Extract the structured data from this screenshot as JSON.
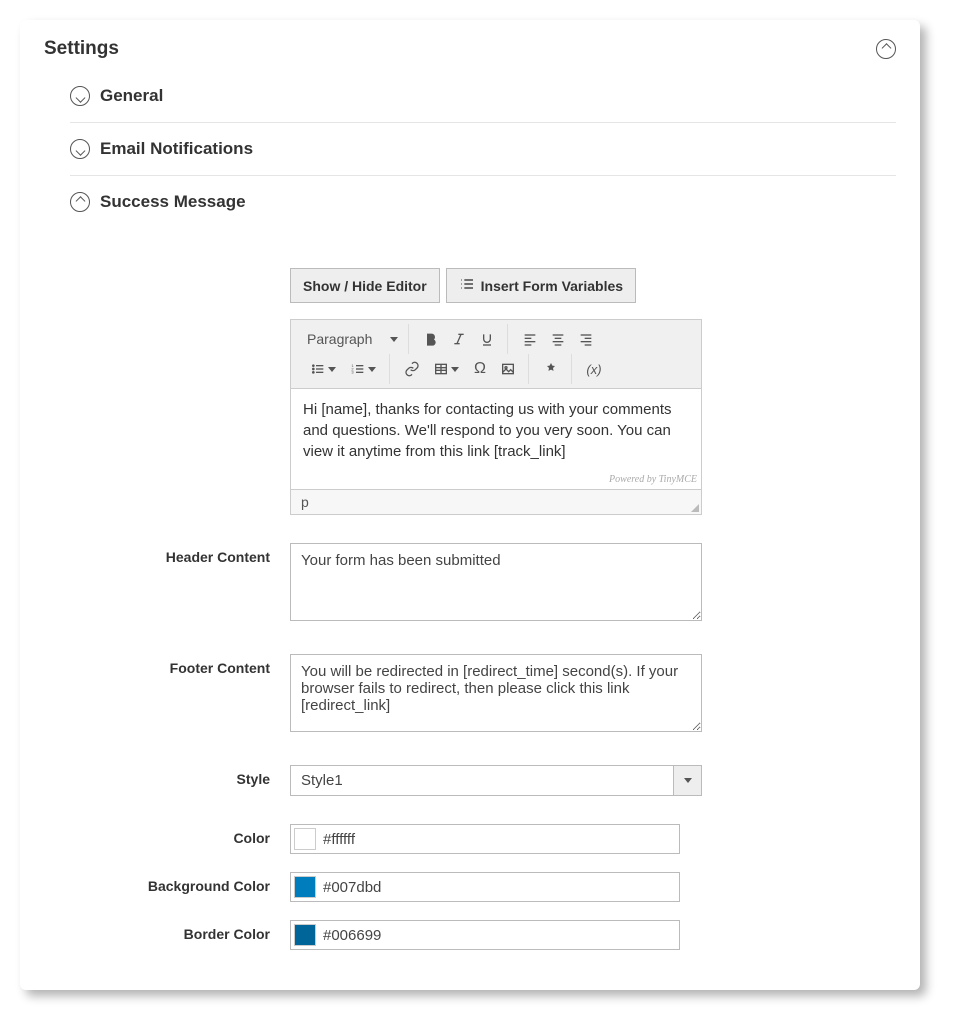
{
  "panel": {
    "title": "Settings"
  },
  "sections": {
    "general": {
      "title": "General"
    },
    "email": {
      "title": "Email Notifications"
    },
    "success": {
      "title": "Success Message"
    }
  },
  "buttons": {
    "toggle_editor": "Show / Hide Editor",
    "insert_vars": "Insert Form Variables"
  },
  "editor": {
    "format_label": "Paragraph",
    "content": "Hi [name], thanks for contacting us with your comments and questions. We'll respond to you very soon. You can view it anytime from this link [track_link]",
    "powered": "Powered by TinyMCE",
    "status_path": "p"
  },
  "fields": {
    "header": {
      "label": "Header Content",
      "value": "Your form has been submitted"
    },
    "footer": {
      "label": "Footer Content",
      "value": "You will be redirected in [redirect_time] second(s). If your browser fails to redirect, then please click this link [redirect_link]"
    },
    "style": {
      "label": "Style",
      "value": "Style1"
    },
    "color": {
      "label": "Color",
      "value": "#ffffff",
      "swatch": "#ffffff"
    },
    "bgcolor": {
      "label": "Background Color",
      "value": "#007dbd",
      "swatch": "#007dbd"
    },
    "bordercolor": {
      "label": "Border Color",
      "value": "#006699",
      "swatch": "#006699"
    }
  }
}
